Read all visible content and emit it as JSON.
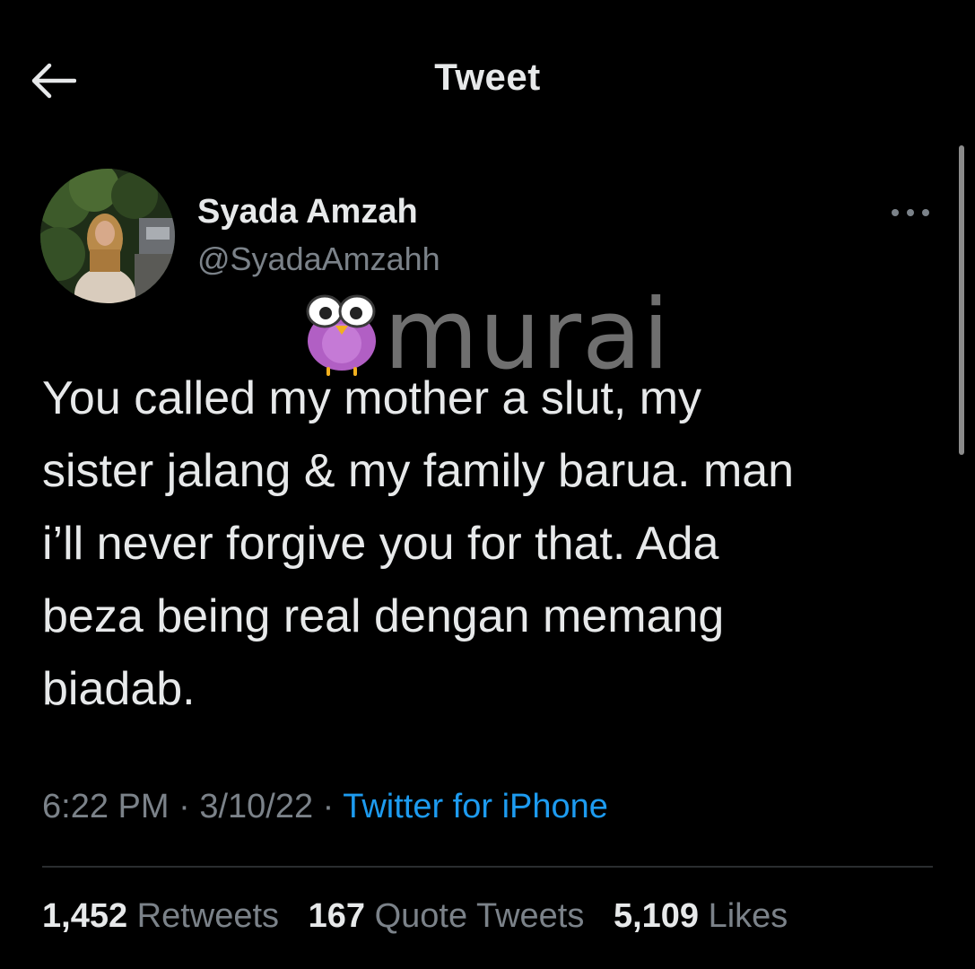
{
  "header": {
    "title": "Tweet",
    "back_icon": "arrow-left-icon"
  },
  "author": {
    "name": "Syada Amzah",
    "handle": "@SyadaAmzahh"
  },
  "more_icon": "ellipsis-icon",
  "watermark": {
    "text": "murai"
  },
  "tweet": {
    "text": "You called my mother a slut, my\nsister jalang & my family barua. man\ni’ll never forgive you for that. Ada\nbeza being real dengan memang\nbiadab."
  },
  "meta": {
    "time": "6:22 PM",
    "sep1": "·",
    "date": "3/10/22",
    "sep2": "·",
    "source": "Twitter for iPhone"
  },
  "stats": {
    "retweets_count": "1,452",
    "retweets_label": "Retweets",
    "quotes_count": "167",
    "quotes_label": "Quote Tweets",
    "likes_count": "5,109",
    "likes_label": "Likes"
  },
  "colors": {
    "background": "#000000",
    "text_primary": "#e7e9ea",
    "text_secondary": "#7b8289",
    "link": "#1d9bf0"
  }
}
